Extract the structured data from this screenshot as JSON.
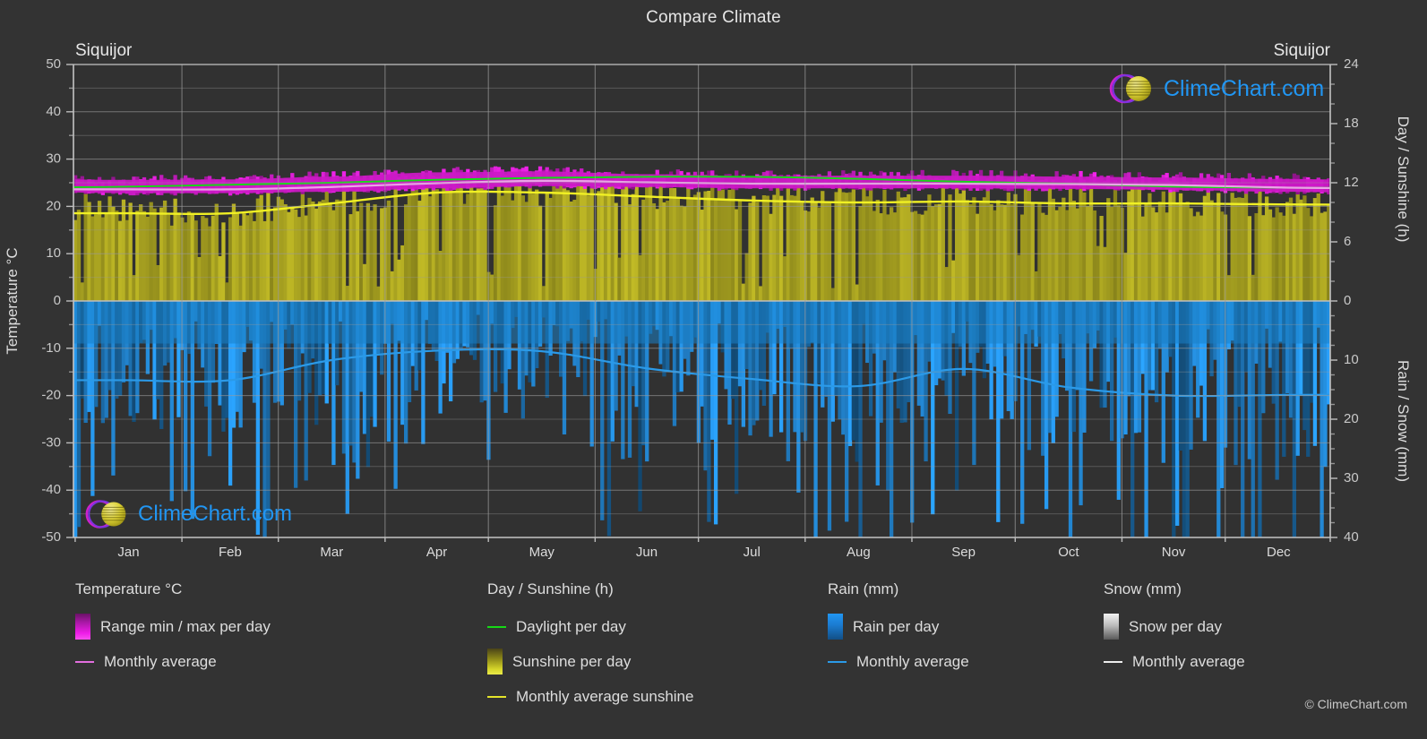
{
  "header": {
    "title": "Compare Climate",
    "location_left": "Siquijor",
    "location_right": "Siquijor"
  },
  "axes": {
    "left_title": "Temperature °C",
    "right_top_title": "Day / Sunshine (h)",
    "right_bottom_title": "Rain / Snow (mm)",
    "left_ticks": [
      "50",
      "40",
      "30",
      "20",
      "10",
      "0",
      "-10",
      "-20",
      "-30",
      "-40",
      "-50"
    ],
    "right_top_ticks": [
      "24",
      "18",
      "12",
      "6",
      "0"
    ],
    "right_bottom_ticks": [
      "0",
      "10",
      "20",
      "30",
      "40"
    ],
    "months": [
      "Jan",
      "Feb",
      "Mar",
      "Apr",
      "May",
      "Jun",
      "Jul",
      "Aug",
      "Sep",
      "Oct",
      "Nov",
      "Dec"
    ]
  },
  "legend": {
    "temperature": {
      "heading": "Temperature °C",
      "items": [
        {
          "label": "Range min / max per day",
          "marker": "gradient-swatch-magenta"
        },
        {
          "label": "Monthly average",
          "marker": "line-pink"
        }
      ]
    },
    "day_sunshine": {
      "heading": "Day / Sunshine (h)",
      "items": [
        {
          "label": "Daylight per day",
          "marker": "line-green"
        },
        {
          "label": "Sunshine per day",
          "marker": "gradient-swatch-yellow"
        },
        {
          "label": "Monthly average sunshine",
          "marker": "line-yellow"
        }
      ]
    },
    "rain": {
      "heading": "Rain (mm)",
      "items": [
        {
          "label": "Rain per day",
          "marker": "gradient-swatch-blue"
        },
        {
          "label": "Monthly average",
          "marker": "line-blue"
        }
      ]
    },
    "snow": {
      "heading": "Snow (mm)",
      "items": [
        {
          "label": "Snow per day",
          "marker": "gradient-swatch-grey"
        },
        {
          "label": "Monthly average",
          "marker": "line-white"
        }
      ]
    }
  },
  "watermark": {
    "text": "ClimeChart.com",
    "copyright": "© ClimeChart.com"
  },
  "colors": {
    "background": "#333333",
    "plot_background": "#313131",
    "grid": "#8c8c8c",
    "axis": "#c4c4c4",
    "temp_range": "#cc19c6",
    "temp_avg_line": "#e26ede",
    "daylight_line": "#16d916",
    "sunshine_fill": "#aaa621",
    "sunshine_avg_line": "#e4e42a",
    "rain_fill": "#1b7fcc",
    "rain_avg_line": "#2b9ae8",
    "snow_fill": "#d0d0d0",
    "text": "#dddddd",
    "link": "#2196f3"
  },
  "chart_data": {
    "type": "area",
    "title": "Compare Climate",
    "subtitle": "Siquijor",
    "xlabel": "",
    "ylabel": "Temperature °C",
    "grid": true,
    "legend_position": "bottom",
    "x": [
      "Jan",
      "Feb",
      "Mar",
      "Apr",
      "May",
      "Jun",
      "Jul",
      "Aug",
      "Sep",
      "Oct",
      "Nov",
      "Dec"
    ],
    "y_axis_left": {
      "label": "Temperature °C",
      "min": -50,
      "max": 50,
      "tick_step": 10,
      "unit": "°C"
    },
    "y_axis_right_top": {
      "label": "Day / Sunshine (h)",
      "min": 0,
      "max": 24,
      "tick_step": 6,
      "unit": "h"
    },
    "y_axis_right_bottom": {
      "label": "Rain / Snow (mm)",
      "min": 0,
      "max": 40,
      "tick_step": 10,
      "unit": "mm"
    },
    "series": [
      {
        "name": "Range min / max per day",
        "type": "band",
        "unit": "°C",
        "min_values": [
          22.8,
          22.8,
          23.1,
          23.8,
          24.3,
          24.1,
          23.8,
          23.8,
          23.8,
          23.7,
          23.5,
          23.1
        ],
        "max_values": [
          25.6,
          25.7,
          26.3,
          27.2,
          27.4,
          26.8,
          26.4,
          26.5,
          26.5,
          26.3,
          26.1,
          25.8
        ]
      },
      {
        "name": "Monthly average temperature",
        "type": "line",
        "unit": "°C",
        "values": [
          23.6,
          23.6,
          24.1,
          24.9,
          25.4,
          25.1,
          24.8,
          24.8,
          24.8,
          24.7,
          24.5,
          24.0
        ]
      },
      {
        "name": "Daylight per day",
        "type": "line",
        "unit": "h",
        "values": [
          11.6,
          11.8,
          12.0,
          12.3,
          12.5,
          12.6,
          12.6,
          12.4,
          12.1,
          11.9,
          11.6,
          11.5
        ]
      },
      {
        "name": "Monthly average sunshine",
        "type": "line",
        "unit": "h",
        "values": [
          8.9,
          8.9,
          9.9,
          11.0,
          11.0,
          10.6,
          10.2,
          10.0,
          10.1,
          9.9,
          9.9,
          9.8
        ]
      },
      {
        "name": "Monthly average rain",
        "type": "line",
        "unit": "mm",
        "values": [
          13.4,
          13.4,
          10.0,
          8.4,
          8.5,
          11.4,
          13.2,
          14.4,
          11.5,
          14.6,
          16.0,
          15.9
        ]
      },
      {
        "name": "Monthly average snow",
        "type": "line",
        "unit": "mm",
        "values": [
          0,
          0,
          0,
          0,
          0,
          0,
          0,
          0,
          0,
          0,
          0,
          0
        ]
      }
    ]
  }
}
